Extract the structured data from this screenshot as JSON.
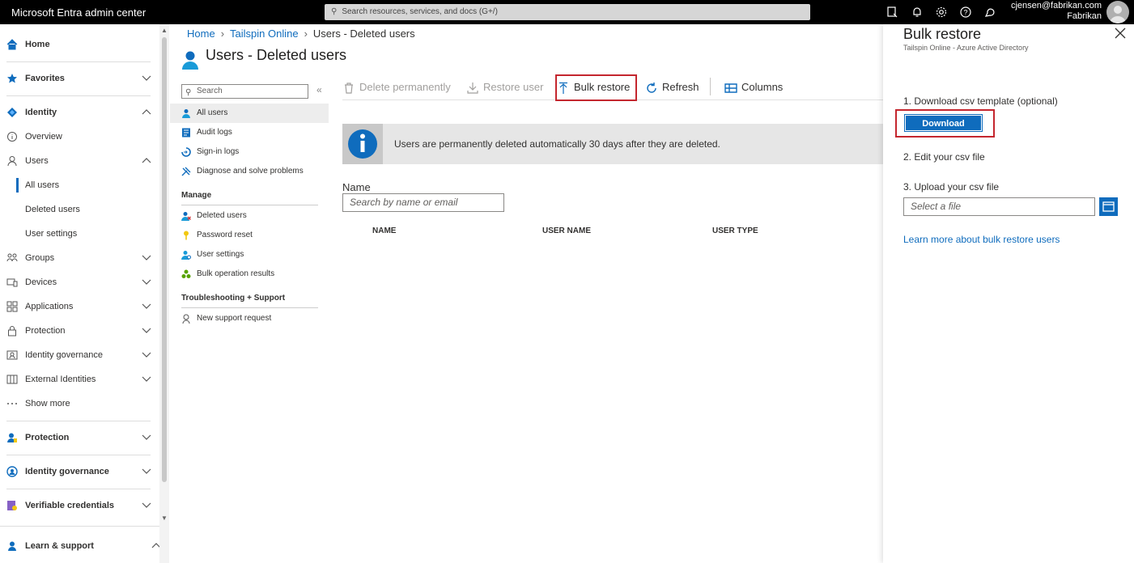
{
  "topbar": {
    "app_title": "Microsoft Entra admin center",
    "search_placeholder": "Search resources, services, and docs (G+/)",
    "account_email": "cjensen@fabrikan.com",
    "account_tenant": "Fabrikan"
  },
  "leftnav": {
    "home": "Home",
    "favorites": "Favorites",
    "identity": "Identity",
    "overview": "Overview",
    "users": "Users",
    "all_users": "All users",
    "deleted_users": "Deleted users",
    "user_settings": "User settings",
    "groups": "Groups",
    "devices": "Devices",
    "applications": "Applications",
    "protection": "Protection",
    "identity_governance": "Identity governance",
    "external_identities": "External Identities",
    "show_more": "Show more",
    "protection_section": "Protection",
    "identity_governance_section": "Identity governance",
    "verifiable_credentials": "Verifiable credentials",
    "learn_support": "Learn & support"
  },
  "breadcrumb": {
    "home": "Home",
    "tenant": "Tailspin Online",
    "current": "Users - Deleted users"
  },
  "page": {
    "title": "Users - Deleted users"
  },
  "innermenu": {
    "search_placeholder": "Search",
    "all_users": "All users",
    "audit_logs": "Audit logs",
    "signin_logs": "Sign-in logs",
    "diagnose": "Diagnose and solve problems",
    "manage_header": "Manage",
    "deleted_users": "Deleted users",
    "password_reset": "Password reset",
    "user_settings": "User settings",
    "bulk_results": "Bulk operation results",
    "troubleshooting_header": "Troubleshooting + Support",
    "new_support": "New support request"
  },
  "toolbar": {
    "delete_permanently": "Delete permanently",
    "restore_user": "Restore user",
    "bulk_restore": "Bulk restore",
    "refresh": "Refresh",
    "columns": "Columns"
  },
  "banner": {
    "text": "Users are permanently deleted automatically 30 days after they are deleted."
  },
  "filter": {
    "name_label": "Name",
    "name_placeholder": "Search by name or email"
  },
  "table": {
    "columns": [
      "NAME",
      "USER NAME",
      "USER TYPE"
    ]
  },
  "panel": {
    "title": "Bulk restore",
    "subtitle": "Tailspin Online - Azure Active Directory",
    "step1": "1. Download csv template (optional)",
    "download": "Download",
    "step2": "2. Edit your csv file",
    "step3": "3. Upload your csv file",
    "file_placeholder": "Select a file",
    "learn_more": "Learn more about bulk restore users"
  },
  "colors": {
    "accent": "#0f6cbd",
    "highlight": "#c4262e",
    "topbar": "#000000"
  }
}
